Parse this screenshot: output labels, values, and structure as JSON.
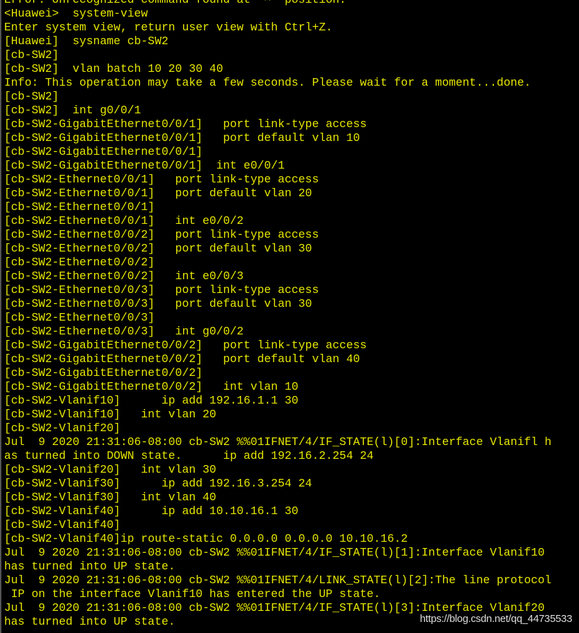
{
  "terminal": {
    "text_color": "#e6e600",
    "background": "#000000",
    "lines": [
      "Error: Unrecognized command found at '^' position.",
      "<Huawei>  system-view",
      "Enter system view, return user view with Ctrl+Z.",
      "[Huawei]  sysname cb-SW2",
      "[cb-SW2]",
      "[cb-SW2]  vlan batch 10 20 30 40",
      "Info: This operation may take a few seconds. Please wait for a moment...done.",
      "[cb-SW2]",
      "[cb-SW2]  int g0/0/1",
      "[cb-SW2-GigabitEthernet0/0/1]   port link-type access",
      "[cb-SW2-GigabitEthernet0/0/1]   port default vlan 10",
      "[cb-SW2-GigabitEthernet0/0/1]",
      "[cb-SW2-GigabitEthernet0/0/1]  int e0/0/1",
      "[cb-SW2-Ethernet0/0/1]   port link-type access",
      "[cb-SW2-Ethernet0/0/1]   port default vlan 20",
      "[cb-SW2-Ethernet0/0/1]",
      "[cb-SW2-Ethernet0/0/1]   int e0/0/2",
      "[cb-SW2-Ethernet0/0/2]   port link-type access",
      "[cb-SW2-Ethernet0/0/2]   port default vlan 30",
      "[cb-SW2-Ethernet0/0/2]",
      "[cb-SW2-Ethernet0/0/2]   int e0/0/3",
      "[cb-SW2-Ethernet0/0/3]   port link-type access",
      "[cb-SW2-Ethernet0/0/3]   port default vlan 30",
      "[cb-SW2-Ethernet0/0/3]",
      "[cb-SW2-Ethernet0/0/3]   int g0/0/2",
      "[cb-SW2-GigabitEthernet0/0/2]   port link-type access",
      "[cb-SW2-GigabitEthernet0/0/2]   port default vlan 40",
      "[cb-SW2-GigabitEthernet0/0/2]",
      "[cb-SW2-GigabitEthernet0/0/2]   int vlan 10",
      "[cb-SW2-Vlanif10]      ip add 192.16.1.1 30",
      "[cb-SW2-Vlanif10]   int vlan 20",
      "[cb-SW2-Vlanif20]",
      "Jul  9 2020 21:31:06-08:00 cb-SW2 %%01IFNET/4/IF_STATE(l)[0]:Interface Vlanifl h",
      "as turned into DOWN state.      ip add 192.16.2.254 24",
      "[cb-SW2-Vlanif20]   int vlan 30",
      "[cb-SW2-Vlanif30]      ip add 192.16.3.254 24",
      "[cb-SW2-Vlanif30]   int vlan 40",
      "[cb-SW2-Vlanif40]      ip add 10.10.16.1 30",
      "[cb-SW2-Vlanif40]",
      "[cb-SW2-Vlanif40]ip route-static 0.0.0.0 0.0.0.0 10.10.16.2",
      "Jul  9 2020 21:31:06-08:00 cb-SW2 %%01IFNET/4/IF_STATE(l)[1]:Interface Vlanif10",
      "has turned into UP state.",
      "Jul  9 2020 21:31:06-08:00 cb-SW2 %%01IFNET/4/LINK_STATE(l)[2]:The line protocol",
      " IP on the interface Vlanif10 has entered the UP state.",
      "Jul  9 2020 21:31:06-08:00 cb-SW2 %%01IFNET/4/IF_STATE(l)[3]:Interface Vlanif20",
      "has turned into UP state."
    ]
  },
  "watermark": "https://blog.csdn.net/qq_44735533"
}
